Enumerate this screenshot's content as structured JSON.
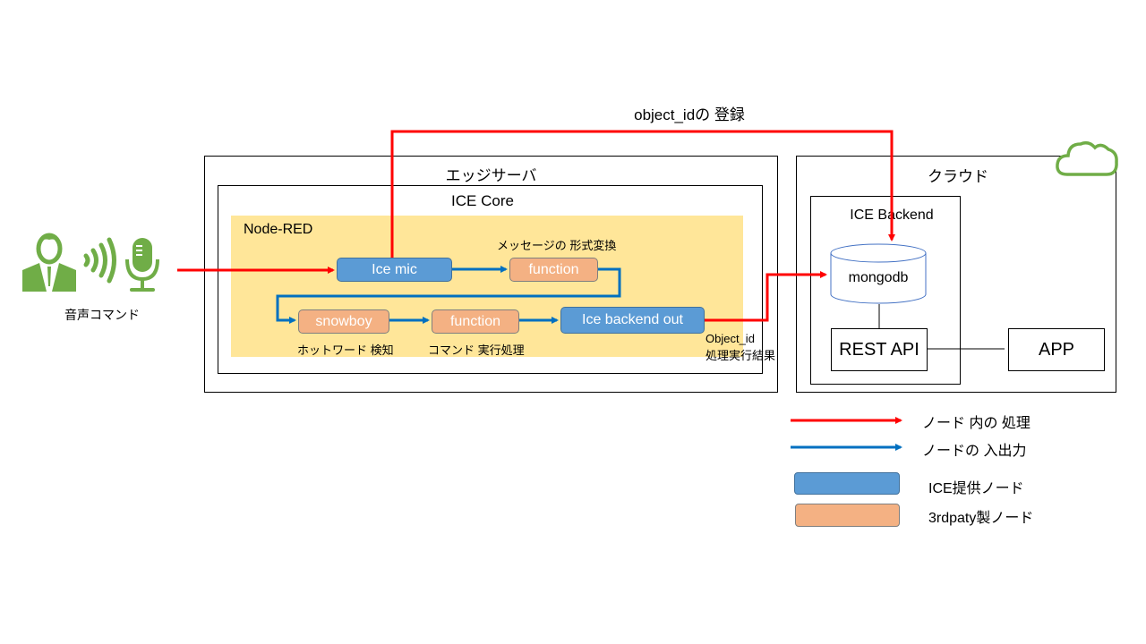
{
  "annotation_top": "object_idの 登録",
  "user": {
    "label": "音声コマンド"
  },
  "edge_server": {
    "title": "エッジサーバ",
    "ice_core": {
      "title": "ICE Core",
      "node_red": {
        "title": "Node-RED",
        "nodes": [
          {
            "id": "ice-mic",
            "label": "Ice mic",
            "kind": "ice"
          },
          {
            "id": "function-1",
            "label": "function",
            "kind": "third",
            "caption": "メッセージの 形式変換"
          },
          {
            "id": "snowboy",
            "label": "snowboy",
            "kind": "third",
            "caption": "ホットワード 検知"
          },
          {
            "id": "function-2",
            "label": "function",
            "kind": "third",
            "caption": "コマンド 実行処理"
          },
          {
            "id": "ice-backend-out",
            "label": "Ice backend out",
            "kind": "ice"
          }
        ]
      }
    },
    "output_caption_line1": "Object_id",
    "output_caption_line2": "処理実行結果"
  },
  "cloud": {
    "title": "クラウド",
    "ice_backend": {
      "title": "ICE Backend",
      "db_label": "mongodb",
      "api_label": "REST API"
    },
    "app_label": "APP"
  },
  "legend": {
    "items": [
      {
        "label": "ノード 内の 処理",
        "type": "arrow",
        "color": "#ff0000"
      },
      {
        "label": "ノードの 入出力",
        "type": "arrow",
        "color": "#0070c0"
      },
      {
        "label": "ICE提供ノード",
        "type": "swatch",
        "color": "#5b9bd5"
      },
      {
        "label": "3rdpaty製ノード",
        "type": "swatch",
        "color": "#f4b183"
      }
    ]
  },
  "colors": {
    "red_flow": "#ff0000",
    "blue_flow": "#0070c0",
    "node_red_bg": "#ffe699",
    "icon_green": "#70ad47",
    "db_stroke": "#4472c4"
  }
}
